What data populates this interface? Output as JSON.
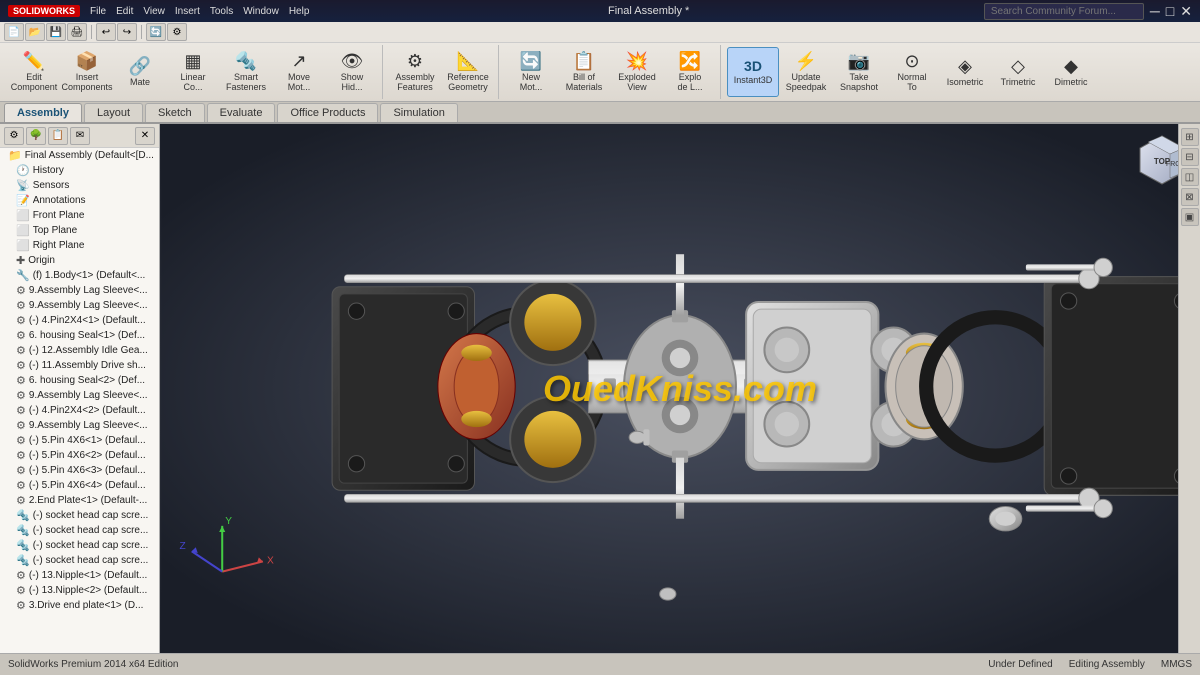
{
  "app": {
    "logo": "SOLIDWORKS",
    "title": "Final Assembly *",
    "search_placeholder": "Search Community Forum..."
  },
  "toolbar_top": {
    "buttons": [
      "File",
      "Edit",
      "View",
      "Insert",
      "Tools",
      "Window",
      "Help",
      "?"
    ]
  },
  "toolbar_main": {
    "groups": [
      {
        "buttons": [
          {
            "label": "Edit\nComponent",
            "icon": "✏️"
          },
          {
            "label": "Insert\nComponents",
            "icon": "📦"
          },
          {
            "label": "Mate",
            "icon": "🔗"
          },
          {
            "label": "Linear\nCo...",
            "icon": "▦"
          },
          {
            "label": "Smart\nFasteners",
            "icon": "🔩"
          },
          {
            "label": "Move\nMot...",
            "icon": "↗"
          },
          {
            "label": "Show\nHid...",
            "icon": "👁"
          }
        ]
      },
      {
        "buttons": [
          {
            "label": "Assembly\nFeatures",
            "icon": "⚙"
          },
          {
            "label": "Reference\nGeometry",
            "icon": "📐"
          }
        ]
      },
      {
        "buttons": [
          {
            "label": "New\nMot...",
            "icon": "🔄"
          },
          {
            "label": "Bill of\nMaterials",
            "icon": "📋"
          },
          {
            "label": "Exploded\nView",
            "icon": "💥"
          },
          {
            "label": "Explo\nde L...",
            "icon": "🔀"
          }
        ]
      },
      {
        "buttons": [
          {
            "label": "Instant3D",
            "icon": "3️⃣",
            "active": true
          },
          {
            "label": "Update\nSpeedpak",
            "icon": "🔄"
          },
          {
            "label": "Take\nSnapshot",
            "icon": "📷"
          },
          {
            "label": "Normal\nTo",
            "icon": "⊙"
          },
          {
            "label": "Isometric",
            "icon": "◈"
          },
          {
            "label": "Trimetric",
            "icon": "◇"
          },
          {
            "label": "Dimetric",
            "icon": "◆"
          }
        ]
      }
    ]
  },
  "tabs": [
    {
      "label": "Assembly",
      "active": true
    },
    {
      "label": "Layout",
      "active": false
    },
    {
      "label": "Sketch",
      "active": false
    },
    {
      "label": "Evaluate",
      "active": false
    },
    {
      "label": "Office Products",
      "active": false
    },
    {
      "label": "Simulation",
      "active": false
    }
  ],
  "feature_tree": {
    "header_tabs": [
      "⚙",
      "🌳",
      "📋",
      "✉"
    ],
    "items": [
      {
        "label": "Final Assembly  (Default<[D...",
        "indent": 0,
        "icon": "📁",
        "type": "root"
      },
      {
        "label": "History",
        "indent": 1,
        "icon": "🕐",
        "type": "folder"
      },
      {
        "label": "Sensors",
        "indent": 1,
        "icon": "📡",
        "type": "folder"
      },
      {
        "label": "Annotations",
        "indent": 1,
        "icon": "📝",
        "type": "folder"
      },
      {
        "label": "Front Plane",
        "indent": 1,
        "icon": "⬜",
        "type": "plane"
      },
      {
        "label": "Top Plane",
        "indent": 1,
        "icon": "⬜",
        "type": "plane"
      },
      {
        "label": "Right Plane",
        "indent": 1,
        "icon": "⬜",
        "type": "plane"
      },
      {
        "label": "Origin",
        "indent": 1,
        "icon": "✚",
        "type": "origin"
      },
      {
        "label": "(f) 1.Body<1> (Default<...",
        "indent": 1,
        "icon": "🔧",
        "type": "part"
      },
      {
        "label": "9.Assembly Lag Sleeve<...",
        "indent": 1,
        "icon": "⚙",
        "type": "part"
      },
      {
        "label": "9.Assembly Lag Sleeve<...",
        "indent": 1,
        "icon": "⚙",
        "type": "part"
      },
      {
        "label": "(-) 4.Pin2X4<1> (Default...",
        "indent": 1,
        "icon": "⚙",
        "type": "part"
      },
      {
        "label": "6. housing Seal<1> (Def...",
        "indent": 1,
        "icon": "⚙",
        "type": "part"
      },
      {
        "label": "(-) 12.Assembly Idle Gea...",
        "indent": 1,
        "icon": "⚙",
        "type": "part"
      },
      {
        "label": "(-) 11.Assembly Drive sh...",
        "indent": 1,
        "icon": "⚙",
        "type": "part"
      },
      {
        "label": "6. housing Seal<2> (Def...",
        "indent": 1,
        "icon": "⚙",
        "type": "part"
      },
      {
        "label": "9.Assembly Lag Sleeve<...",
        "indent": 1,
        "icon": "⚙",
        "type": "part"
      },
      {
        "label": "(-) 4.Pin2X4<2> (Default...",
        "indent": 1,
        "icon": "⚙",
        "type": "part"
      },
      {
        "label": "9.Assembly Lag Sleeve<...",
        "indent": 1,
        "icon": "⚙",
        "type": "part"
      },
      {
        "label": "(-) 5.Pin 4X6<1> (Defaul...",
        "indent": 1,
        "icon": "⚙",
        "type": "part"
      },
      {
        "label": "(-) 5.Pin 4X6<2> (Defaul...",
        "indent": 1,
        "icon": "⚙",
        "type": "part"
      },
      {
        "label": "(-) 5.Pin 4X6<3> (Defaul...",
        "indent": 1,
        "icon": "⚙",
        "type": "part"
      },
      {
        "label": "(-) 5.Pin 4X6<4> (Defaul...",
        "indent": 1,
        "icon": "⚙",
        "type": "part"
      },
      {
        "label": "2.End Plate<1> (Default-...",
        "indent": 1,
        "icon": "⚙",
        "type": "part"
      },
      {
        "label": "(-) socket head cap scre...",
        "indent": 1,
        "icon": "🔩",
        "type": "part"
      },
      {
        "label": "(-) socket head cap scre...",
        "indent": 1,
        "icon": "🔩",
        "type": "part"
      },
      {
        "label": "(-) socket head cap scre...",
        "indent": 1,
        "icon": "🔩",
        "type": "part"
      },
      {
        "label": "(-) socket head cap scre...",
        "indent": 1,
        "icon": "🔩",
        "type": "part"
      },
      {
        "label": "(-) 13.Nipple<1> (Default...",
        "indent": 1,
        "icon": "⚙",
        "type": "part"
      },
      {
        "label": "(-) 13.Nipple<2> (Default...",
        "indent": 1,
        "icon": "⚙",
        "type": "part"
      },
      {
        "label": "3.Drive end plate<1> (D...",
        "indent": 1,
        "icon": "⚙",
        "type": "part"
      }
    ]
  },
  "nav_buttons": [
    "🔍+",
    "🔍-",
    "🔍▭",
    "↩",
    "↪",
    "⟳",
    "⬛",
    "⬡",
    "✥",
    "📍",
    "➡"
  ],
  "right_panel_buttons": [
    "⊞",
    "⊟",
    "⊠",
    "⊡",
    "▣"
  ],
  "statusbar": {
    "left": "SolidWorks Premium 2014 x64 Edition",
    "under_defined": "Under Defined",
    "editing": "Editing Assembly",
    "units": "MMGS"
  },
  "watermark": "OuedKniss.com",
  "colors": {
    "accent_blue": "#1a5276",
    "solidworks_red": "#cc0000",
    "active_tab": "#1a5276"
  }
}
